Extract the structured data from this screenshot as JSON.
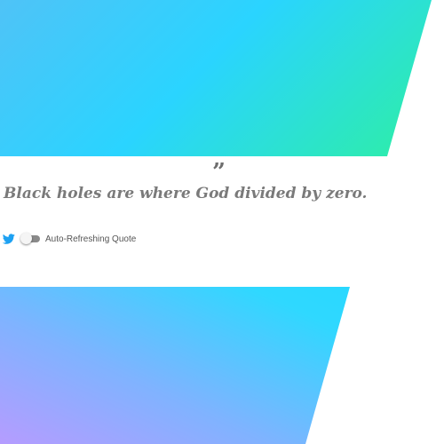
{
  "quote": {
    "mark": "”",
    "text": "Black holes are where God divided by zero."
  },
  "share": {
    "icon": "twitter-icon",
    "color": "#1da1f2"
  },
  "auto_refresh": {
    "label": "Auto-Refreshing Quote",
    "enabled": false
  },
  "colors": {
    "top_gradient": [
      "#4fc3f7",
      "#2ad4ff",
      "#2ef0a0"
    ],
    "bottom_gradient": [
      "#b59cff",
      "#7fb3ff",
      "#2fd8ff"
    ],
    "quote_text": "#7a7a7a"
  }
}
